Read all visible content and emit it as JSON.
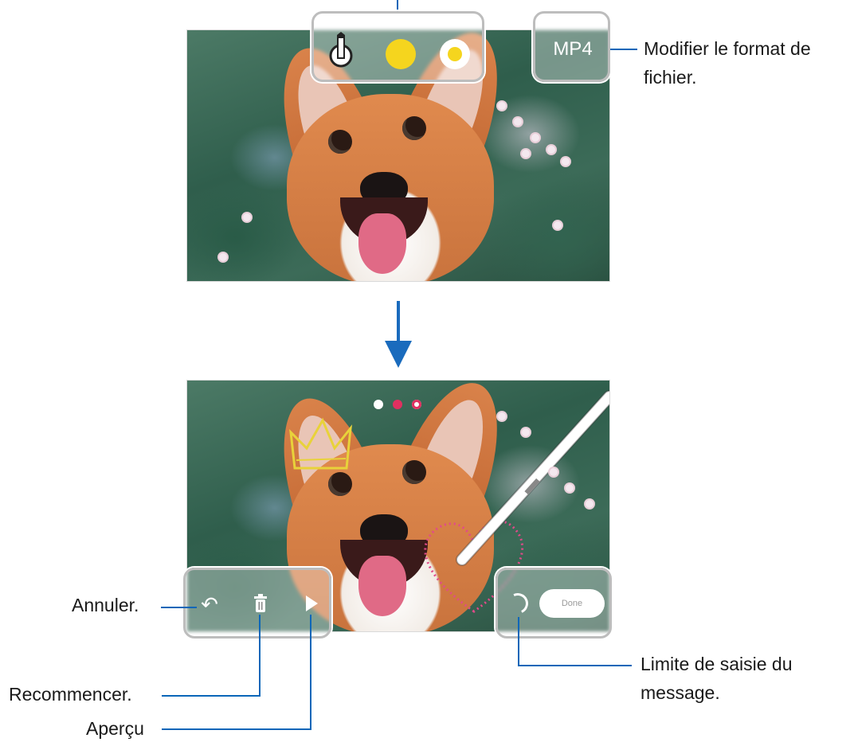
{
  "top_editor": {
    "tools": {
      "pen_icon": "pen-icon",
      "color_dot": "#f5d51e",
      "effect_dot": "#f5d51e"
    },
    "format_button": "MP4",
    "format_caption": [
      "Modifier le format de",
      "fichier."
    ]
  },
  "transition_arrow": "arrow-down-icon",
  "bottom_editor": {
    "mini_tool_colors": [
      "#e03060",
      "#ffffff"
    ],
    "left_controls": {
      "undo_icon": "↶",
      "delete_icon": "🗑",
      "play_icon": "▶"
    },
    "right_controls": {
      "done_label": "Done"
    }
  },
  "annotations": {
    "undo": "Annuler.",
    "restart": "Recommencer.",
    "preview": "Aperçu",
    "limit": [
      "Limite de saisie du",
      "message."
    ]
  },
  "colors": {
    "accent_line": "#0a66b8",
    "arrow": "#1a6bbd",
    "yellow": "#f5d51e"
  }
}
